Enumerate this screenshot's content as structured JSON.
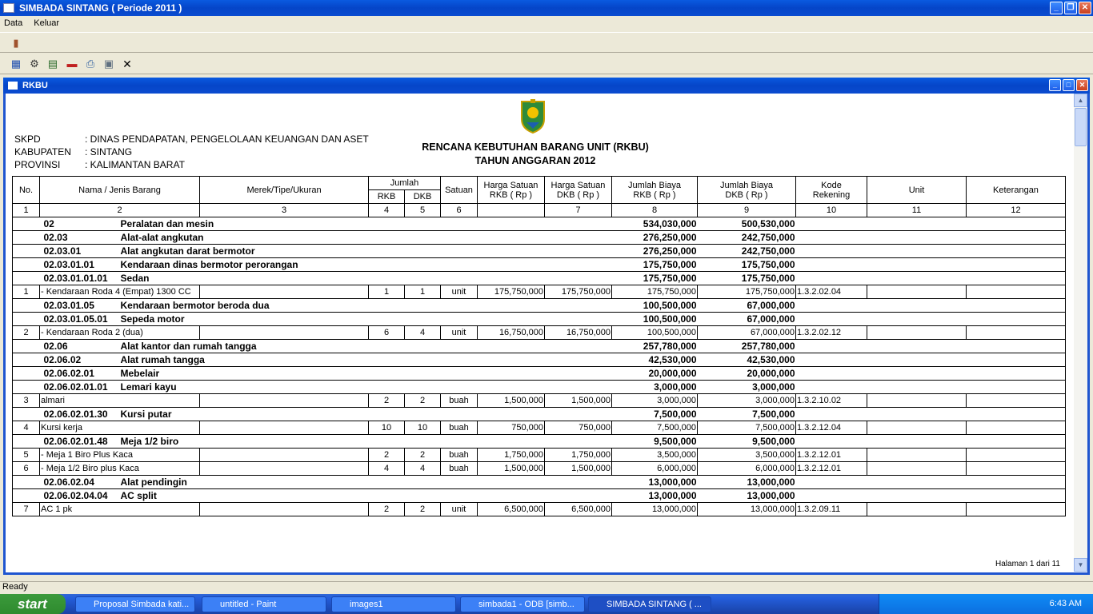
{
  "window": {
    "title": "SIMBADA SINTANG ( Periode 2011 )"
  },
  "menu": [
    "Data",
    "Keluar"
  ],
  "child_window": {
    "title": "RKBU"
  },
  "report": {
    "header": {
      "skpd_label": "SKPD",
      "skpd_value": ": DINAS PENDAPATAN, PENGELOLAAN KEUANGAN DAN ASET",
      "kab_label": "KABUPATEN",
      "kab_value": ": SINTANG",
      "prov_label": "PROVINSI",
      "prov_value": ": KALIMANTAN BARAT"
    },
    "title1": "RENCANA KEBUTUHAN BARANG UNIT (RKBU)",
    "title2": "TAHUN ANGGARAN 2012",
    "columns": {
      "no": "No.",
      "nama": "Nama / Jenis Barang",
      "merek": "Merek/Tipe/Ukuran",
      "jumlah": "Jumlah",
      "rkb": "RKB",
      "dkb": "DKB",
      "satuan": "Satuan",
      "harga_rkb": "Harga Satuan RKB ( Rp )",
      "harga_dkb": "Harga Satuan DKB ( Rp )",
      "biaya_rkb": "Jumlah Biaya RKB ( Rp )",
      "biaya_dkb": "Jumlah Biaya DKB ( Rp )",
      "kode": "Kode Rekening",
      "unit": "Unit",
      "ket": "Keterangan"
    },
    "colnums": [
      "1",
      "2",
      "3",
      "4",
      "5",
      "6",
      "",
      "7",
      "8",
      "9",
      "10",
      "11",
      "12"
    ],
    "rows": [
      {
        "t": "g",
        "code": "02",
        "name": "Peralatan dan mesin",
        "rkb": "534,030,000",
        "dkb": "500,530,000"
      },
      {
        "t": "g",
        "code": "02.03",
        "name": "Alat-alat angkutan",
        "rkb": "276,250,000",
        "dkb": "242,750,000"
      },
      {
        "t": "g",
        "code": "02.03.01",
        "name": "Alat angkutan darat bermotor",
        "rkb": "276,250,000",
        "dkb": "242,750,000"
      },
      {
        "t": "g",
        "code": "02.03.01.01",
        "name": "Kendaraan dinas bermotor perorangan",
        "rkb": "175,750,000",
        "dkb": "175,750,000"
      },
      {
        "t": "g",
        "code": "02.03.01.01.01",
        "name": "Sedan",
        "rkb": "175,750,000",
        "dkb": "175,750,000"
      },
      {
        "t": "i",
        "no": "1",
        "nama": "- Kendaraan Roda 4 (Empat) 1300 CC",
        "merek": "",
        "jr": "1",
        "jd": "1",
        "sat": "unit",
        "hr": "175,750,000",
        "hd": "175,750,000",
        "br": "175,750,000",
        "bd": "175,750,000",
        "kode": "1.3.2.02.04"
      },
      {
        "t": "g",
        "code": "02.03.01.05",
        "name": "Kendaraan bermotor beroda dua",
        "rkb": "100,500,000",
        "dkb": "67,000,000"
      },
      {
        "t": "g",
        "code": "02.03.01.05.01",
        "name": "Sepeda motor",
        "rkb": "100,500,000",
        "dkb": "67,000,000"
      },
      {
        "t": "i",
        "no": "2",
        "nama": "- Kendaraan Roda 2 (dua)",
        "merek": "",
        "jr": "6",
        "jd": "4",
        "sat": "unit",
        "hr": "16,750,000",
        "hd": "16,750,000",
        "br": "100,500,000",
        "bd": "67,000,000",
        "kode": "1.3.2.02.12"
      },
      {
        "t": "g",
        "code": "02.06",
        "name": "Alat kantor dan rumah tangga",
        "rkb": "257,780,000",
        "dkb": "257,780,000"
      },
      {
        "t": "g",
        "code": "02.06.02",
        "name": "Alat rumah tangga",
        "rkb": "42,530,000",
        "dkb": "42,530,000"
      },
      {
        "t": "g",
        "code": "02.06.02.01",
        "name": "Mebelair",
        "rkb": "20,000,000",
        "dkb": "20,000,000"
      },
      {
        "t": "g",
        "code": "02.06.02.01.01",
        "name": "Lemari kayu",
        "rkb": "3,000,000",
        "dkb": "3,000,000"
      },
      {
        "t": "i",
        "no": "3",
        "nama": "almari",
        "merek": "",
        "jr": "2",
        "jd": "2",
        "sat": "buah",
        "hr": "1,500,000",
        "hd": "1,500,000",
        "br": "3,000,000",
        "bd": "3,000,000",
        "kode": "1.3.2.10.02"
      },
      {
        "t": "g",
        "code": "02.06.02.01.30",
        "name": "Kursi putar",
        "rkb": "7,500,000",
        "dkb": "7,500,000"
      },
      {
        "t": "i",
        "no": "4",
        "nama": "Kursi kerja",
        "merek": "",
        "jr": "10",
        "jd": "10",
        "sat": "buah",
        "hr": "750,000",
        "hd": "750,000",
        "br": "7,500,000",
        "bd": "7,500,000",
        "kode": "1.3.2.12.04"
      },
      {
        "t": "g",
        "code": "02.06.02.01.48",
        "name": "Meja 1/2 biro",
        "rkb": "9,500,000",
        "dkb": "9,500,000"
      },
      {
        "t": "i",
        "no": "5",
        "nama": "- Meja 1 Biro Plus Kaca",
        "merek": "",
        "jr": "2",
        "jd": "2",
        "sat": "buah",
        "hr": "1,750,000",
        "hd": "1,750,000",
        "br": "3,500,000",
        "bd": "3,500,000",
        "kode": "1.3.2.12.01"
      },
      {
        "t": "i",
        "no": "6",
        "nama": "- Meja 1/2 Biro plus Kaca",
        "merek": "",
        "jr": "4",
        "jd": "4",
        "sat": "buah",
        "hr": "1,500,000",
        "hd": "1,500,000",
        "br": "6,000,000",
        "bd": "6,000,000",
        "kode": "1.3.2.12.01"
      },
      {
        "t": "g",
        "code": "02.06.02.04",
        "name": "Alat pendingin",
        "rkb": "13,000,000",
        "dkb": "13,000,000"
      },
      {
        "t": "g",
        "code": "02.06.02.04.04",
        "name": "AC  split",
        "rkb": "13,000,000",
        "dkb": "13,000,000"
      },
      {
        "t": "i",
        "no": "7",
        "nama": "AC 1 pk",
        "merek": "",
        "jr": "2",
        "jd": "2",
        "sat": "unit",
        "hr": "6,500,000",
        "hd": "6,500,000",
        "br": "13,000,000",
        "bd": "13,000,000",
        "kode": "1.3.2.09.11"
      }
    ],
    "page_info": "Halaman 1 dari 11"
  },
  "status": "Ready",
  "taskbar": {
    "start": "start",
    "tasks": [
      "Proposal Simbada kati...",
      "untitled - Paint",
      "images1",
      "simbada1 - ODB [simb...",
      "SIMBADA SINTANG ( ..."
    ],
    "clock": "6:43 AM"
  }
}
